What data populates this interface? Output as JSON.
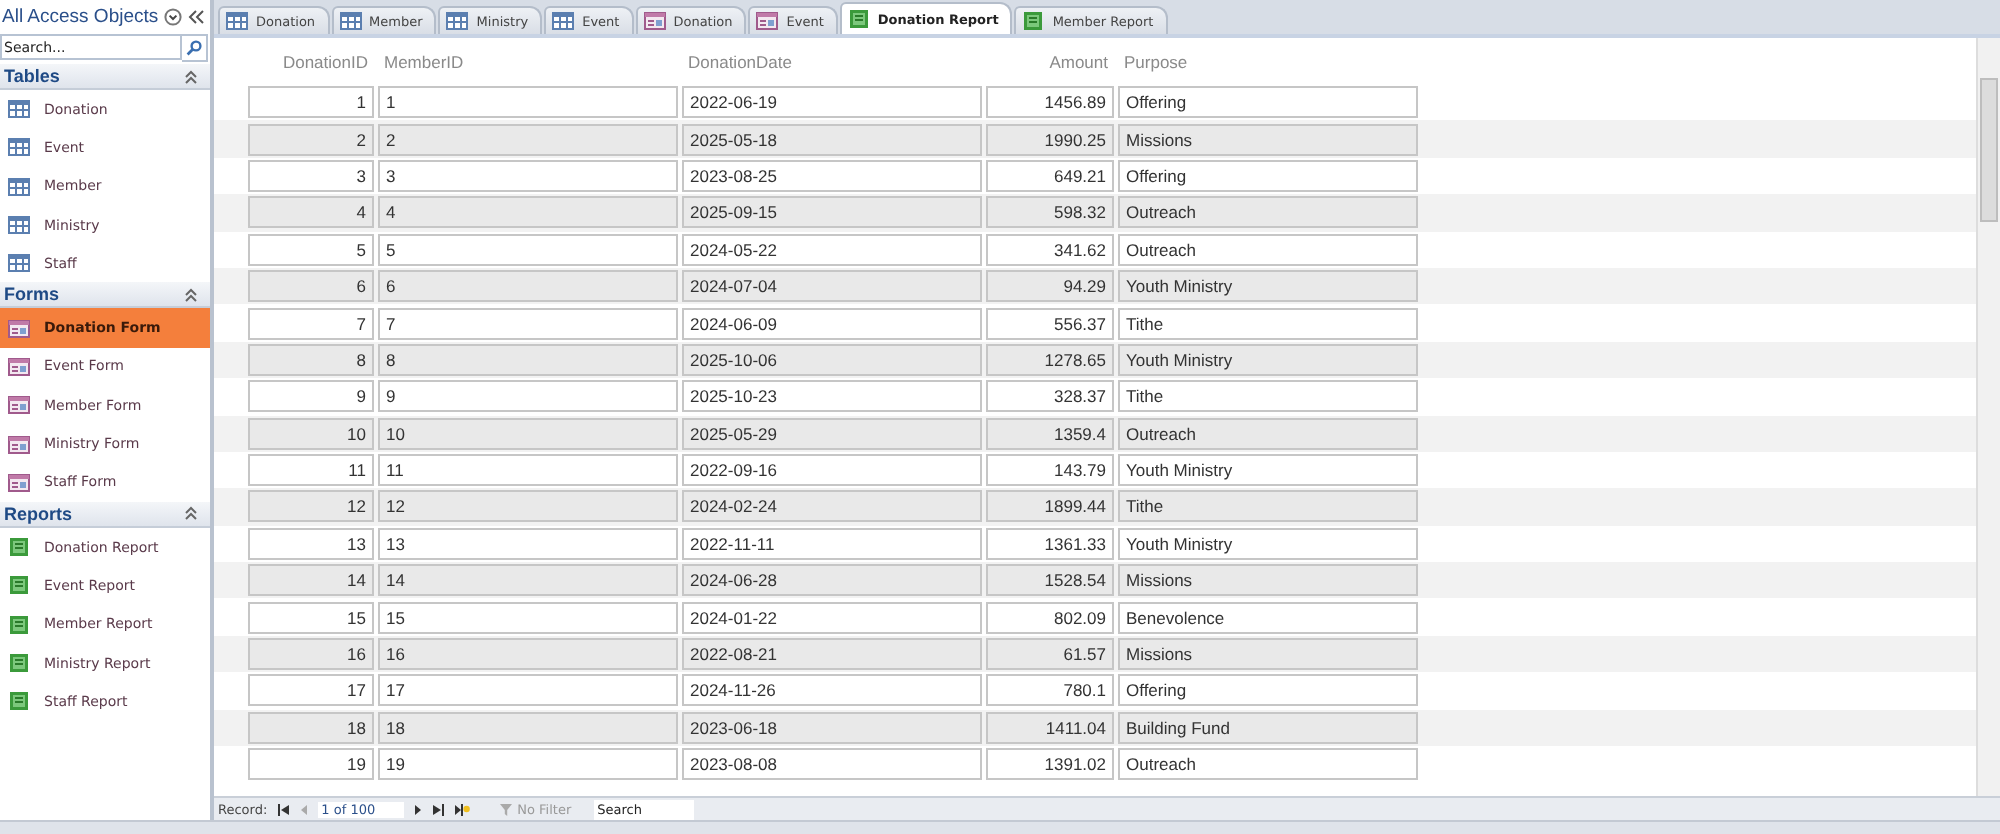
{
  "nav_pane": {
    "title": "All Access Objects",
    "search": {
      "placeholder": "Search..."
    },
    "groups": [
      {
        "title": "Tables",
        "kind": "table",
        "items": [
          {
            "label": "Donation",
            "selected": false
          },
          {
            "label": "Event",
            "selected": false
          },
          {
            "label": "Member",
            "selected": false
          },
          {
            "label": "Ministry",
            "selected": false
          },
          {
            "label": "Staff",
            "selected": false
          }
        ]
      },
      {
        "title": "Forms",
        "kind": "form",
        "items": [
          {
            "label": "Donation Form",
            "selected": true
          },
          {
            "label": "Event Form",
            "selected": false
          },
          {
            "label": "Member Form",
            "selected": false
          },
          {
            "label": "Ministry Form",
            "selected": false
          },
          {
            "label": "Staff Form",
            "selected": false
          }
        ]
      },
      {
        "title": "Reports",
        "kind": "report",
        "items": [
          {
            "label": "Donation Report",
            "selected": false
          },
          {
            "label": "Event Report",
            "selected": false
          },
          {
            "label": "Member Report",
            "selected": false
          },
          {
            "label": "Ministry Report",
            "selected": false
          },
          {
            "label": "Staff Report",
            "selected": false
          }
        ]
      }
    ]
  },
  "tabs": [
    {
      "label": "Donation",
      "kind": "table",
      "selected": false
    },
    {
      "label": "Member",
      "kind": "table",
      "selected": false
    },
    {
      "label": "Ministry",
      "kind": "table",
      "selected": false
    },
    {
      "label": "Event",
      "kind": "table",
      "selected": false
    },
    {
      "label": "Donation",
      "kind": "form",
      "selected": false
    },
    {
      "label": "Event",
      "kind": "form",
      "selected": false
    },
    {
      "label": "Donation Report",
      "kind": "report",
      "selected": true
    },
    {
      "label": "Member Report",
      "kind": "report",
      "selected": false
    }
  ],
  "table": {
    "columns": [
      "DonationID",
      "MemberID",
      "DonationDate",
      "Amount",
      "Purpose"
    ],
    "rows": [
      [
        "1",
        "1",
        "2022-06-19",
        "1456.89",
        "Offering"
      ],
      [
        "2",
        "2",
        "2025-05-18",
        "1990.25",
        "Missions"
      ],
      [
        "3",
        "3",
        "2023-08-25",
        "649.21",
        "Offering"
      ],
      [
        "4",
        "4",
        "2025-09-15",
        "598.32",
        "Outreach"
      ],
      [
        "5",
        "5",
        "2024-05-22",
        "341.62",
        "Outreach"
      ],
      [
        "6",
        "6",
        "2024-07-04",
        "94.29",
        "Youth Ministry"
      ],
      [
        "7",
        "7",
        "2024-06-09",
        "556.37",
        "Tithe"
      ],
      [
        "8",
        "8",
        "2025-10-06",
        "1278.65",
        "Youth Ministry"
      ],
      [
        "9",
        "9",
        "2025-10-23",
        "328.37",
        "Tithe"
      ],
      [
        "10",
        "10",
        "2025-05-29",
        "1359.4",
        "Outreach"
      ],
      [
        "11",
        "11",
        "2022-09-16",
        "143.79",
        "Youth Ministry"
      ],
      [
        "12",
        "12",
        "2024-02-24",
        "1899.44",
        "Tithe"
      ],
      [
        "13",
        "13",
        "2022-11-11",
        "1361.33",
        "Youth Ministry"
      ],
      [
        "14",
        "14",
        "2024-06-28",
        "1528.54",
        "Missions"
      ],
      [
        "15",
        "15",
        "2024-01-22",
        "802.09",
        "Benevolence"
      ],
      [
        "16",
        "16",
        "2022-08-21",
        "61.57",
        "Missions"
      ],
      [
        "17",
        "17",
        "2024-11-26",
        "780.1",
        "Offering"
      ],
      [
        "18",
        "18",
        "2023-06-18",
        "1411.04",
        "Building Fund"
      ],
      [
        "19",
        "19",
        "2023-08-08",
        "1391.02",
        "Outreach"
      ]
    ]
  },
  "record_bar": {
    "label": "Record:",
    "position": "1 of 100",
    "filter": "No Filter",
    "search": {
      "placeholder": "Search"
    }
  }
}
